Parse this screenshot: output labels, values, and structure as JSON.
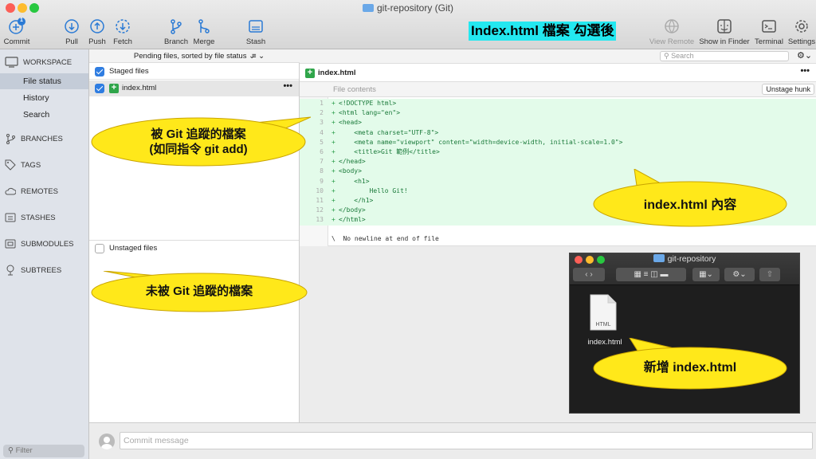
{
  "window": {
    "title": "git-repository (Git)"
  },
  "toolbar": {
    "commit": "Commit",
    "commit_badge": "1",
    "pull": "Pull",
    "push": "Push",
    "fetch": "Fetch",
    "branch": "Branch",
    "merge": "Merge",
    "stash": "Stash",
    "view_remote": "View Remote",
    "show_in_finder": "Show in Finder",
    "terminal": "Terminal",
    "settings": "Settings"
  },
  "annotation_banner": "Index.html 檔案 勾選後",
  "sidebar": {
    "workspace": "WORKSPACE",
    "items": [
      "File status",
      "History",
      "Search"
    ],
    "sections": [
      "BRANCHES",
      "TAGS",
      "REMOTES",
      "STASHES",
      "SUBMODULES",
      "SUBTREES"
    ],
    "filter_placeholder": "Filter"
  },
  "files": {
    "sort_label": "Pending files, sorted by file status",
    "staged_header": "Staged files",
    "staged_items": [
      "index.html"
    ],
    "unstaged_header": "Unstaged files"
  },
  "callouts": {
    "staged_note_line1": "被 Git 追蹤的檔案",
    "staged_note_line2": "(如同指令 git add)",
    "unstaged_note": "未被 Git 追蹤的檔案",
    "content_note": "index.html 內容",
    "new_file_note": "新增 index.html"
  },
  "diff": {
    "search_placeholder": "Search",
    "file_name": "index.html",
    "file_contents_label": "File contents",
    "unstage_hunk": "Unstage hunk",
    "lines": [
      {
        "n": "1",
        "code": "<!DOCTYPE html>"
      },
      {
        "n": "2",
        "code": "<html lang=\"en\">"
      },
      {
        "n": "3",
        "code": "<head>"
      },
      {
        "n": "4",
        "code": "    <meta charset=\"UTF-8\">"
      },
      {
        "n": "5",
        "code": "    <meta name=\"viewport\" content=\"width=device-width, initial-scale=1.0\">"
      },
      {
        "n": "6",
        "code": "    <title>Git 範例</title>"
      },
      {
        "n": "7",
        "code": "</head>"
      },
      {
        "n": "8",
        "code": "<body>"
      },
      {
        "n": "9",
        "code": "    <h1>"
      },
      {
        "n": "10",
        "code": "        Hello Git!"
      },
      {
        "n": "11",
        "code": "    </h1>"
      },
      {
        "n": "12",
        "code": "</body>"
      },
      {
        "n": "13",
        "code": "</html>"
      }
    ],
    "no_newline": "\\  No newline at end of file"
  },
  "finder": {
    "title": "git-repository",
    "file_name": "index.html",
    "file_type": "HTML"
  },
  "commit": {
    "placeholder": "Commit message"
  }
}
